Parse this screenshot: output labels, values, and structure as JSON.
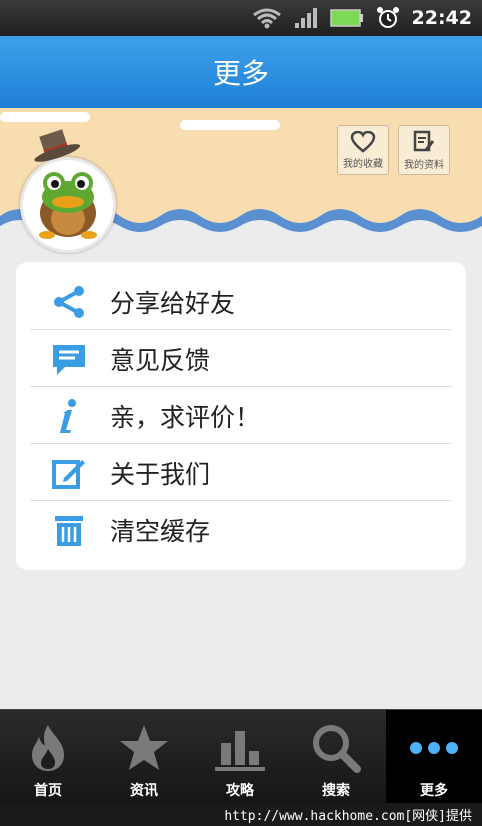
{
  "status_bar": {
    "time": "22:42"
  },
  "header": {
    "title": "更多"
  },
  "banner": {
    "favorites_label": "我的收藏",
    "profile_label": "我的资料"
  },
  "menu": {
    "items": [
      {
        "label": "分享给好友",
        "icon": "share-icon"
      },
      {
        "label": "意见反馈",
        "icon": "feedback-icon"
      },
      {
        "label": "亲，求评价！",
        "icon": "info-icon"
      },
      {
        "label": "关于我们",
        "icon": "edit-icon"
      },
      {
        "label": "清空缓存",
        "icon": "trash-icon"
      }
    ]
  },
  "tabs": [
    {
      "label": "首页",
      "icon": "fire-icon"
    },
    {
      "label": "资讯",
      "icon": "star-icon"
    },
    {
      "label": "攻略",
      "icon": "bar-chart-icon"
    },
    {
      "label": "搜索",
      "icon": "search-icon"
    },
    {
      "label": "更多",
      "icon": "more-icon",
      "active": true
    }
  ],
  "watermark": "http://www.hackhome.com[网侠]提供",
  "colors": {
    "accent": "#1f86d8",
    "icon_blue": "#3a9de4",
    "banner": "#f7ddb0"
  }
}
